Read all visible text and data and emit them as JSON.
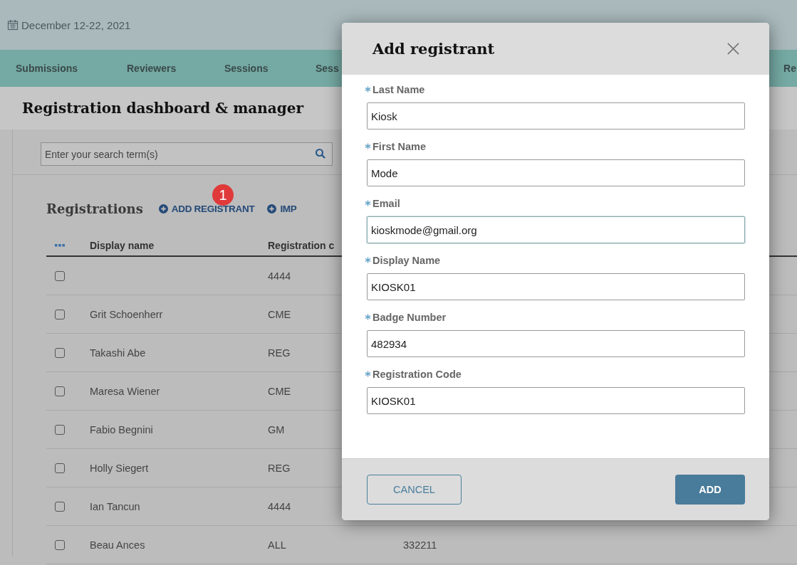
{
  "event": {
    "date": "December 12-22, 2021"
  },
  "nav": [
    {
      "label": "Submissions"
    },
    {
      "label": "Reviewers"
    },
    {
      "label": "Sessions"
    },
    {
      "label": "Sess"
    },
    {
      "label": "Re"
    }
  ],
  "page": {
    "title": "Registration dashboard & manager"
  },
  "search": {
    "placeholder": "Enter your search term(s)"
  },
  "registrations": {
    "title": "Registrations",
    "actions": [
      {
        "label": "ADD REGISTRANT"
      },
      {
        "label": "IMP"
      }
    ],
    "step_badge": "1"
  },
  "table": {
    "columns": [
      {
        "label": "Display name"
      },
      {
        "label": "Registration c"
      }
    ],
    "rows": [
      {
        "checked": false,
        "name": "",
        "code": "4444"
      },
      {
        "checked": false,
        "name": "Grit Schoenherr",
        "code": "CME"
      },
      {
        "checked": false,
        "name": "Takashi Abe",
        "code": "REG"
      },
      {
        "checked": false,
        "name": "Maresa Wiener",
        "code": "CME"
      },
      {
        "checked": false,
        "name": "Fabio Begnini",
        "code": "GM"
      },
      {
        "checked": false,
        "name": "Holly Siegert",
        "code": "REG"
      },
      {
        "checked": false,
        "name": "Ian Tancun",
        "code": "4444"
      },
      {
        "checked": false,
        "name": "Beau Ances",
        "code": "ALL",
        "column_3": "332211"
      }
    ]
  },
  "dialog": {
    "title": "Add registrant",
    "fields": [
      {
        "label": "Last Name",
        "required": true,
        "value": "Kiosk",
        "focused": false
      },
      {
        "label": "First Name",
        "required": true,
        "value": "Mode",
        "focused": false
      },
      {
        "label": "Email",
        "required": true,
        "value": "kioskmode@gmail.org",
        "focused": true
      },
      {
        "label": "Display Name",
        "required": true,
        "value": "KIOSK01",
        "focused": false
      },
      {
        "label": "Badge Number",
        "required": true,
        "value": "482934",
        "focused": false
      },
      {
        "label": "Registration Code",
        "required": true,
        "value": "KIOSK01",
        "focused": false
      }
    ],
    "buttons": [
      {
        "label": "CANCEL",
        "kind": "secondary"
      },
      {
        "label": "ADD",
        "kind": "primary"
      }
    ]
  }
}
